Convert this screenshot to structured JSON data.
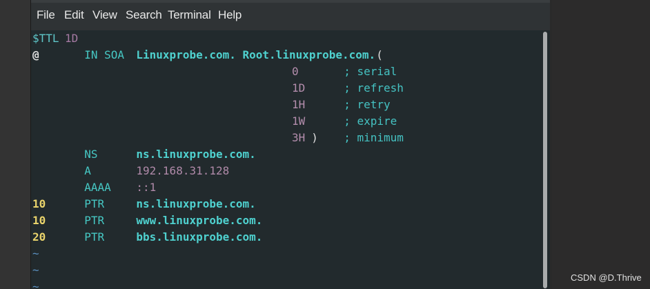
{
  "menubar": {
    "items": [
      "File",
      "Edit",
      "View",
      "Search",
      "Terminal",
      "Help"
    ]
  },
  "terminal": {
    "lines": [
      {
        "tokens": [
          {
            "text": "$TTL",
            "cls": "c-var",
            "col": 0
          },
          {
            "text": "1D",
            "cls": "c-ttl",
            "col": 5
          }
        ]
      },
      {
        "tokens": [
          {
            "text": "@",
            "cls": "c-at",
            "col": 0
          },
          {
            "text": "IN SOA",
            "cls": "c-kw",
            "col": 8
          },
          {
            "text": "Linuxprobe.com. Root.linuxprobe.com.",
            "cls": "c-name",
            "col": 16
          },
          {
            "text": "(",
            "cls": "c-paren",
            "col": 53
          }
        ]
      },
      {
        "tokens": [
          {
            "text": "0",
            "cls": "c-num",
            "col": 40
          },
          {
            "text": "; serial",
            "cls": "c-cmt",
            "col": 48
          }
        ]
      },
      {
        "tokens": [
          {
            "text": "1D",
            "cls": "c-num",
            "col": 40
          },
          {
            "text": "; refresh",
            "cls": "c-cmt",
            "col": 48
          }
        ]
      },
      {
        "tokens": [
          {
            "text": "1H",
            "cls": "c-num",
            "col": 40
          },
          {
            "text": "; retry",
            "cls": "c-cmt",
            "col": 48
          }
        ]
      },
      {
        "tokens": [
          {
            "text": "1W",
            "cls": "c-num",
            "col": 40
          },
          {
            "text": "; expire",
            "cls": "c-cmt",
            "col": 48
          }
        ]
      },
      {
        "tokens": [
          {
            "text": "3H",
            "cls": "c-num",
            "col": 40
          },
          {
            "text": ")",
            "cls": "c-paren",
            "col": 43
          },
          {
            "text": "; minimum",
            "cls": "c-cmt",
            "col": 48
          }
        ]
      },
      {
        "tokens": [
          {
            "text": "NS",
            "cls": "c-kw",
            "col": 8
          },
          {
            "text": "ns.linuxprobe.com.",
            "cls": "c-name",
            "col": 16
          }
        ]
      },
      {
        "tokens": [
          {
            "text": "A",
            "cls": "c-kw",
            "col": 8
          },
          {
            "text": "192.168.31.128",
            "cls": "c-ip",
            "col": 16
          }
        ]
      },
      {
        "tokens": [
          {
            "text": "AAAA",
            "cls": "c-kw",
            "col": 8
          },
          {
            "text": "::1",
            "cls": "c-ip",
            "col": 16
          }
        ]
      },
      {
        "tokens": [
          {
            "text": "10",
            "cls": "c-yellow",
            "col": 0
          },
          {
            "text": "PTR",
            "cls": "c-kw",
            "col": 8
          },
          {
            "text": "ns.linuxprobe.com.",
            "cls": "c-name",
            "col": 16
          }
        ]
      },
      {
        "tokens": [
          {
            "text": "10",
            "cls": "c-yellow",
            "col": 0
          },
          {
            "text": "PTR",
            "cls": "c-kw",
            "col": 8
          },
          {
            "text": "www.linuxprobe.com.",
            "cls": "c-name",
            "col": 16
          }
        ]
      },
      {
        "tokens": [
          {
            "text": "20",
            "cls": "c-yellow",
            "col": 0
          },
          {
            "text": "PTR",
            "cls": "c-kw",
            "col": 8
          },
          {
            "text": "bbs.linuxprobe.com.",
            "cls": "c-name",
            "col": 16
          }
        ]
      },
      {
        "tokens": [
          {
            "text": "~",
            "cls": "c-tilde",
            "col": 0
          }
        ]
      },
      {
        "tokens": [
          {
            "text": "~",
            "cls": "c-tilde",
            "col": 0
          }
        ]
      },
      {
        "tokens": [
          {
            "text": "~",
            "cls": "c-tilde",
            "col": 0
          }
        ]
      }
    ]
  },
  "watermark": "CSDN @D.Thrive"
}
